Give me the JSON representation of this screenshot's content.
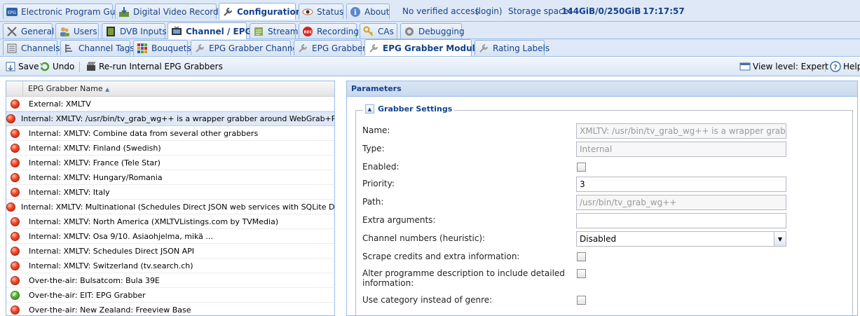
{
  "top_tabs": [
    {
      "label": "Electronic Program Guide",
      "icon": "epg-icon"
    },
    {
      "label": "Digital Video Recorder",
      "icon": "dvr-icon"
    },
    {
      "label": "Configuration",
      "icon": "wrench-icon",
      "active": true
    },
    {
      "label": "Status",
      "icon": "eye-icon"
    },
    {
      "label": "About",
      "icon": "info-icon"
    }
  ],
  "status": {
    "access": "No verified access",
    "login": "(login)",
    "storage_label": "Storage space:",
    "storage_value": "144GiB/0/250GiB",
    "time": "17:17:57"
  },
  "config_tabs": [
    {
      "label": "General",
      "icon": "tools-icon"
    },
    {
      "label": "Users",
      "icon": "users-icon"
    },
    {
      "label": "DVB Inputs",
      "icon": "film-icon"
    },
    {
      "label": "Channel / EPG",
      "icon": "tv-icon",
      "active": true
    },
    {
      "label": "Stream",
      "icon": "stream-icon"
    },
    {
      "label": "Recording",
      "icon": "rec-icon"
    },
    {
      "label": "CAs",
      "icon": "key-icon"
    },
    {
      "label": "Debugging",
      "icon": "debug-icon"
    }
  ],
  "channel_tabs": [
    {
      "label": "Channels",
      "icon": "channels-icon"
    },
    {
      "label": "Channel Tags",
      "icon": "tags-icon"
    },
    {
      "label": "Bouquets",
      "icon": "bouquets-icon"
    },
    {
      "label": "EPG Grabber Channels",
      "icon": "grabber-icon"
    },
    {
      "label": "EPG Grabber",
      "icon": "grabber-icon"
    },
    {
      "label": "EPG Grabber Modules",
      "icon": "grabber-icon",
      "active": true
    },
    {
      "label": "Rating Labels",
      "icon": "grabber-icon"
    }
  ],
  "toolbar": {
    "save": "Save",
    "undo": "Undo",
    "rerun": "Re-run Internal EPG Grabbers",
    "view_level": "View level: Expert",
    "help": "Help"
  },
  "grid": {
    "column": "EPG Grabber Name",
    "rows": [
      {
        "name": "External: XMLTV",
        "enabled": false
      },
      {
        "name": "Internal: XMLTV: /usr/bin/tv_grab_wg++ is a wrapper grabber around WebGrab+Plus",
        "enabled": false,
        "selected": true
      },
      {
        "name": "Internal: XMLTV: Combine data from several other grabbers",
        "enabled": false
      },
      {
        "name": "Internal: XMLTV: Finland (Swedish)",
        "enabled": false
      },
      {
        "name": "Internal: XMLTV: France (Tele Star)",
        "enabled": false
      },
      {
        "name": "Internal: XMLTV: Hungary/Romania",
        "enabled": false
      },
      {
        "name": "Internal: XMLTV: Italy",
        "enabled": false
      },
      {
        "name": "Internal: XMLTV: Multinational (Schedules Direct JSON web services with SQLite DB)",
        "enabled": false
      },
      {
        "name": "Internal: XMLTV: North America (XMLTVListings.com by TVMedia)",
        "enabled": false
      },
      {
        "name": "Internal: XMLTV: Osa 9/10. Asiaohjelma, mikä ...",
        "enabled": false
      },
      {
        "name": "Internal: XMLTV: Schedules Direct JSON API",
        "enabled": false
      },
      {
        "name": "Internal: XMLTV: Switzerland (tv.search.ch)",
        "enabled": false
      },
      {
        "name": "Over-the-air: Bulsatcom: Bula 39E",
        "enabled": false
      },
      {
        "name": "Over-the-air: EIT: EPG Grabber",
        "enabled": true
      },
      {
        "name": "Over-the-air: New Zealand: Freeview Base",
        "enabled": false
      }
    ]
  },
  "params": {
    "title": "Parameters",
    "group": "Grabber Settings",
    "name_label": "Name:",
    "name_value": "XMLTV: /usr/bin/tv_grab_wg++ is a wrapper grabber a",
    "type_label": "Type:",
    "type_value": "Internal",
    "enabled_label": "Enabled:",
    "priority_label": "Priority:",
    "priority_value": "3",
    "path_label": "Path:",
    "path_value": "/usr/bin/tv_grab_wg++",
    "extra_label": "Extra arguments:",
    "extra_value": "",
    "chnum_label": "Channel numbers (heuristic):",
    "chnum_value": "Disabled",
    "scrape_label": "Scrape credits and extra information:",
    "alter_label_1": "Alter programme description to include detailed",
    "alter_label_2": "information:",
    "category_label": "Use category instead of genre:"
  }
}
